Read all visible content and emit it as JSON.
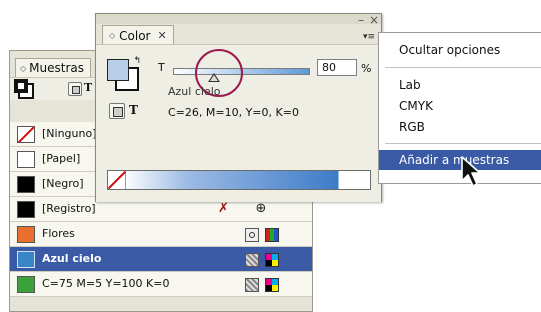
{
  "swatches_panel": {
    "tab_label": "Muestras",
    "toolbar_t": "T",
    "rows": [
      {
        "name": "[Ninguno]",
        "chip": "none",
        "icons": [
          "x"
        ]
      },
      {
        "name": "[Papel]",
        "chip": "#ffffff",
        "icons": []
      },
      {
        "name": "[Negro]",
        "chip": "#000000",
        "icons": []
      },
      {
        "name": "[Registro]",
        "chip": "#000000",
        "icons": [
          "x",
          "registration"
        ]
      },
      {
        "name": "Flores",
        "chip": "#e86f2c",
        "icons": [
          "spot",
          "lab"
        ]
      },
      {
        "name": "Azul cielo",
        "chip": "#3a85c6",
        "icons": [
          "process",
          "cmyk"
        ],
        "selected": true
      },
      {
        "name": "C=75 M=5 Y=100 K=0",
        "chip": "#3aa13b",
        "icons": [
          "process",
          "cmyk"
        ]
      }
    ]
  },
  "color_panel": {
    "tab_label": "Color",
    "slider_label": "T",
    "tint_value": "80",
    "tint_fraction": 0.3,
    "unit": "%",
    "swatch_name": "Azul cielo",
    "cmyk_text": "C=26, M=10, Y=0, K=0",
    "t_glyph": "T",
    "minimize_glyph": "–",
    "close_glyph": "×",
    "menu_glyph": "▾≡"
  },
  "flyout_menu": {
    "items": [
      "Ocultar opciones",
      "Lab",
      "CMYK",
      "RGB",
      "Añadir a muestras"
    ],
    "highlighted": "Añadir a muestras"
  },
  "colors": {
    "selection": "#3a5aa6",
    "highlight_ring": "#9b1a50"
  }
}
